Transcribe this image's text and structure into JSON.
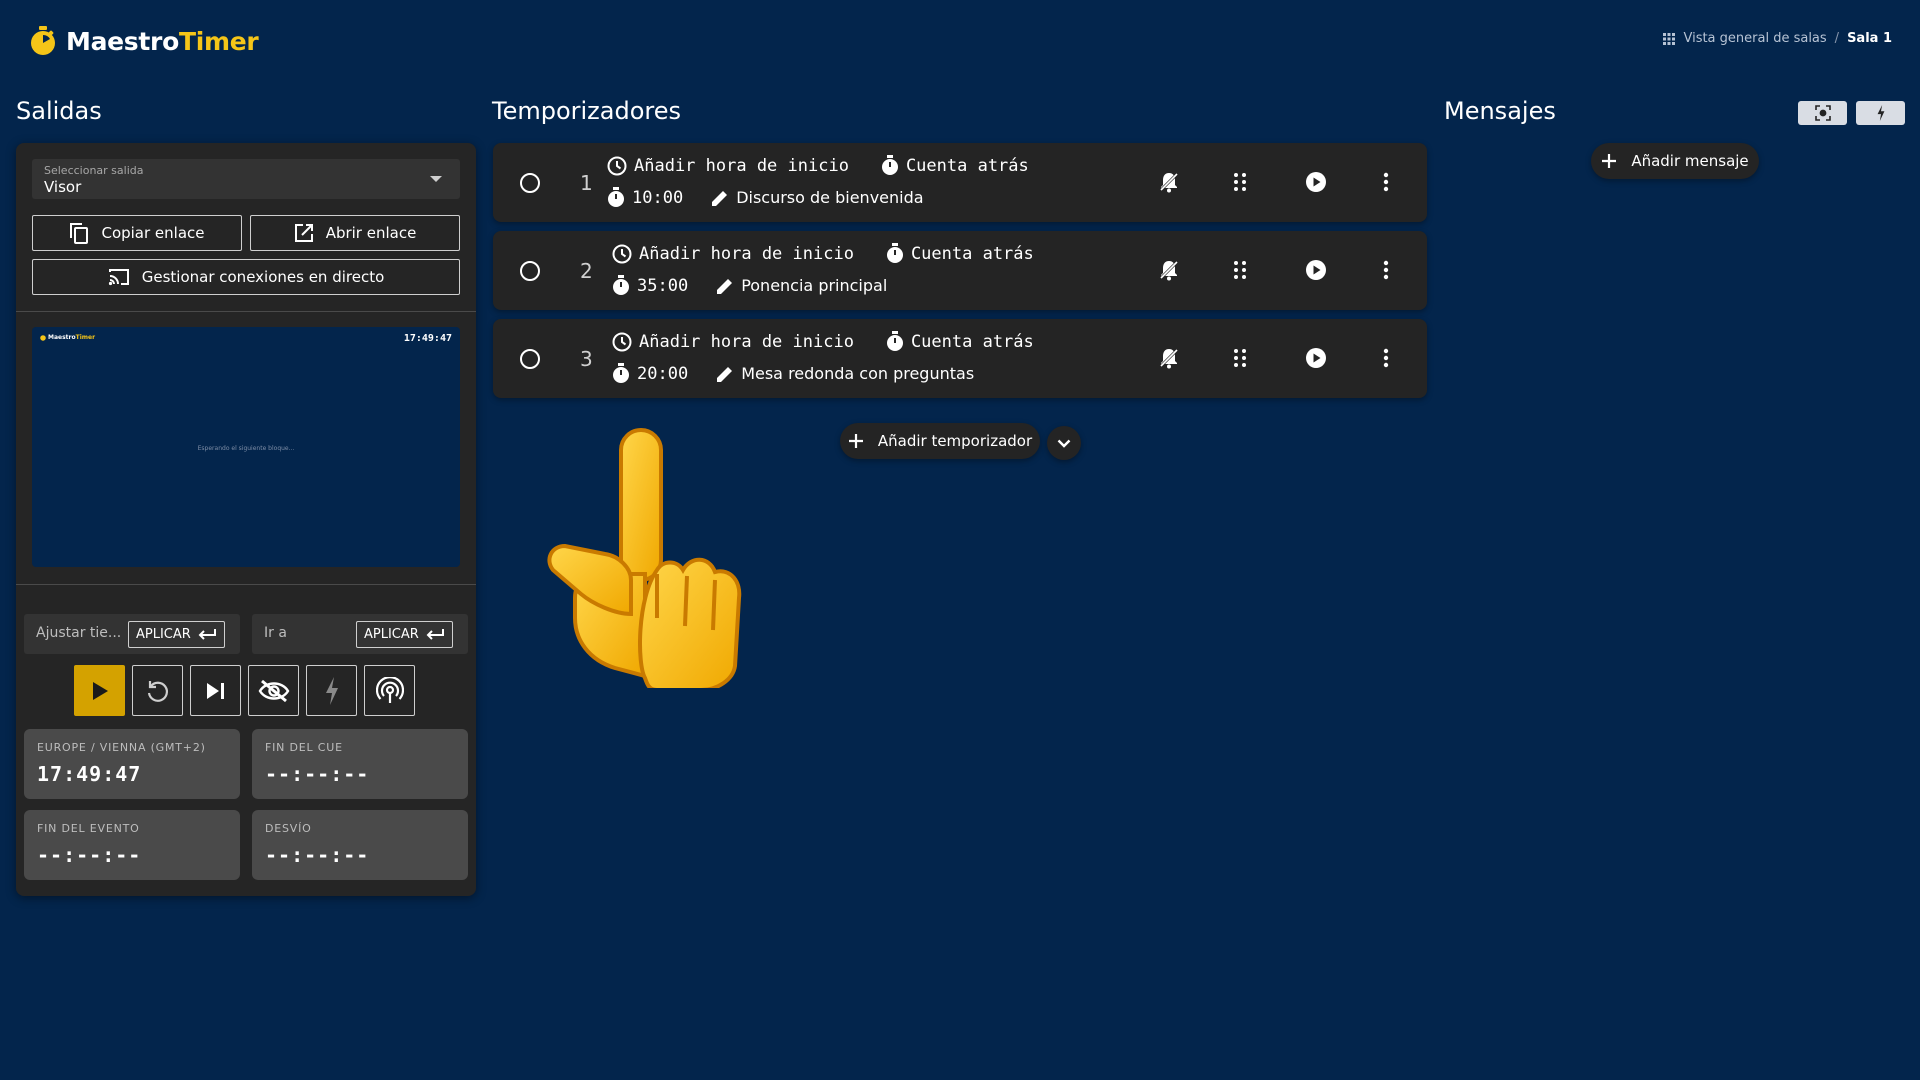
{
  "header": {
    "logo_prefix": "Maestro",
    "logo_suffix": "Timer",
    "breadcrumb": {
      "overview": "Vista general de salas",
      "separator": "/",
      "current": "Sala 1"
    }
  },
  "outputs": {
    "title": "Salidas",
    "select": {
      "label": "Seleccionar salida",
      "value": "Visor"
    },
    "copy_link": "Copiar enlace",
    "open_link": "Abrir enlace",
    "manage_connections": "Gestionar conexiones en directo",
    "preview": {
      "logo_prefix": "Maestro",
      "logo_suffix": "Timer",
      "clock": "17:49:47",
      "message": "Esperando el siguiente bloque..."
    },
    "adjust_time": {
      "placeholder": "Ajustar tie...",
      "apply": "APLICAR"
    },
    "go_to": {
      "placeholder": "Ir a",
      "apply": "APLICAR"
    },
    "info": [
      {
        "label": "EUROPE / VIENNA (GMT+2)",
        "value": "17:49:47"
      },
      {
        "label": "FIN DEL CUE",
        "value": "--:--:--"
      },
      {
        "label": "FIN DEL EVENTO",
        "value": "--:--:--"
      },
      {
        "label": "DESVÍO",
        "value": "--:--:--"
      }
    ]
  },
  "timers": {
    "title": "Temporizadores",
    "items": [
      {
        "index": "1",
        "start": "Añadir hora de inicio",
        "mode": "Cuenta atrás",
        "duration": "10:00",
        "name": "Discurso de bienvenida"
      },
      {
        "index": "2",
        "start": "Añadir hora de inicio",
        "mode": "Cuenta atrás",
        "duration": "35:00",
        "name": "Ponencia principal"
      },
      {
        "index": "3",
        "start": "Añadir hora de inicio",
        "mode": "Cuenta atrás",
        "duration": "20:00",
        "name": "Mesa redonda con preguntas"
      }
    ],
    "add_label": "Añadir temporizador"
  },
  "messages": {
    "title": "Mensajes",
    "add_label": "Añadir mensaje"
  },
  "colors": {
    "background": "#03254c",
    "panel": "#242424",
    "accent": "#f5c518",
    "active_control": "#d4a200"
  },
  "icons": [
    "stopwatch-icon",
    "grid-icon",
    "copy-icon",
    "open-external-icon",
    "cast-icon",
    "enter-icon",
    "play-icon",
    "reset-icon",
    "skip-next-icon",
    "eye-off-icon",
    "flash-icon",
    "broadcast-icon",
    "clock-icon",
    "timer-icon",
    "pencil-icon",
    "alarm-off-icon",
    "drag-handle-icon",
    "play-circle-icon",
    "more-vert-icon",
    "plus-icon",
    "chevron-down-icon",
    "focus-icon",
    "pointing-hand-icon"
  ]
}
